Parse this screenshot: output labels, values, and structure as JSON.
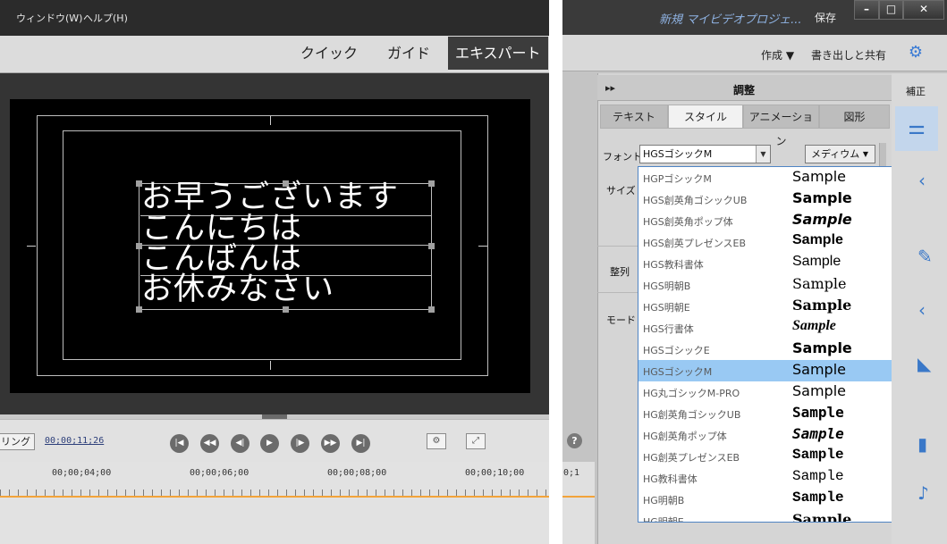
{
  "left": {
    "menu": [
      "ウィンドウ(W)",
      "ヘルプ(H)"
    ],
    "modes": [
      "クイック",
      "ガイド",
      "エキスパート"
    ],
    "active_mode": "エキスパート",
    "title_lines": [
      "お早うございます",
      "こんにちは",
      "こんばんは",
      "お休みなさい"
    ],
    "render_label": "リング",
    "timecode": "00;00;11;26",
    "ruler_labels": [
      "00;00;04;00",
      "00;00;06;00",
      "00;00;08;00",
      "00;00;10;00"
    ]
  },
  "right": {
    "project_title": "新規 マイビデオプロジェ...",
    "save_label": "保存",
    "window_buttons": [
      "–",
      "□",
      "✕"
    ],
    "toolbar": {
      "create": "作成 ▼",
      "export": "書き出しと共有"
    },
    "panel_title": "調整",
    "panel_chevron": "▸▸",
    "side_label": "補正",
    "tabs": [
      "テキスト",
      "スタイル",
      "アニメーション",
      "図形"
    ],
    "selected_tab": "スタイル",
    "labels": {
      "font": "フォント",
      "size": "サイズ",
      "align": "整列",
      "mode": "モード"
    },
    "font_value": "HGSゴシックM",
    "weight_value": "メディウム",
    "highlighted_font": "HGSゴシックM",
    "timeline_stub": "0;1",
    "font_list": [
      {
        "name": "HGPゴシックM",
        "sample": "Sample"
      },
      {
        "name": "HGS創英角ゴシックUB",
        "sample": "Sample"
      },
      {
        "name": "HGS創英角ポップ体",
        "sample": "Sample"
      },
      {
        "name": "HGS創英プレゼンスEB",
        "sample": "Sample"
      },
      {
        "name": "HGS教科書体",
        "sample": "Sample"
      },
      {
        "name": "HGS明朝B",
        "sample": "Sample"
      },
      {
        "name": "HGS明朝E",
        "sample": "Sample"
      },
      {
        "name": "HGS行書体",
        "sample": "Sample"
      },
      {
        "name": "HGSゴシックE",
        "sample": "Sample"
      },
      {
        "name": "HGSゴシックM",
        "sample": "Sample"
      },
      {
        "name": "HG丸ゴシックM-PRO",
        "sample": "Sample"
      },
      {
        "name": "HG創英角ゴシックUB",
        "sample": "Sample"
      },
      {
        "name": "HG創英角ポップ体",
        "sample": "Sample"
      },
      {
        "name": "HG創英プレゼンスEB",
        "sample": "Sample"
      },
      {
        "name": "HG教科書体",
        "sample": "Sample"
      },
      {
        "name": "HG明朝B",
        "sample": "Sample"
      },
      {
        "name": "HG明朝E",
        "sample": "Sample"
      }
    ]
  }
}
